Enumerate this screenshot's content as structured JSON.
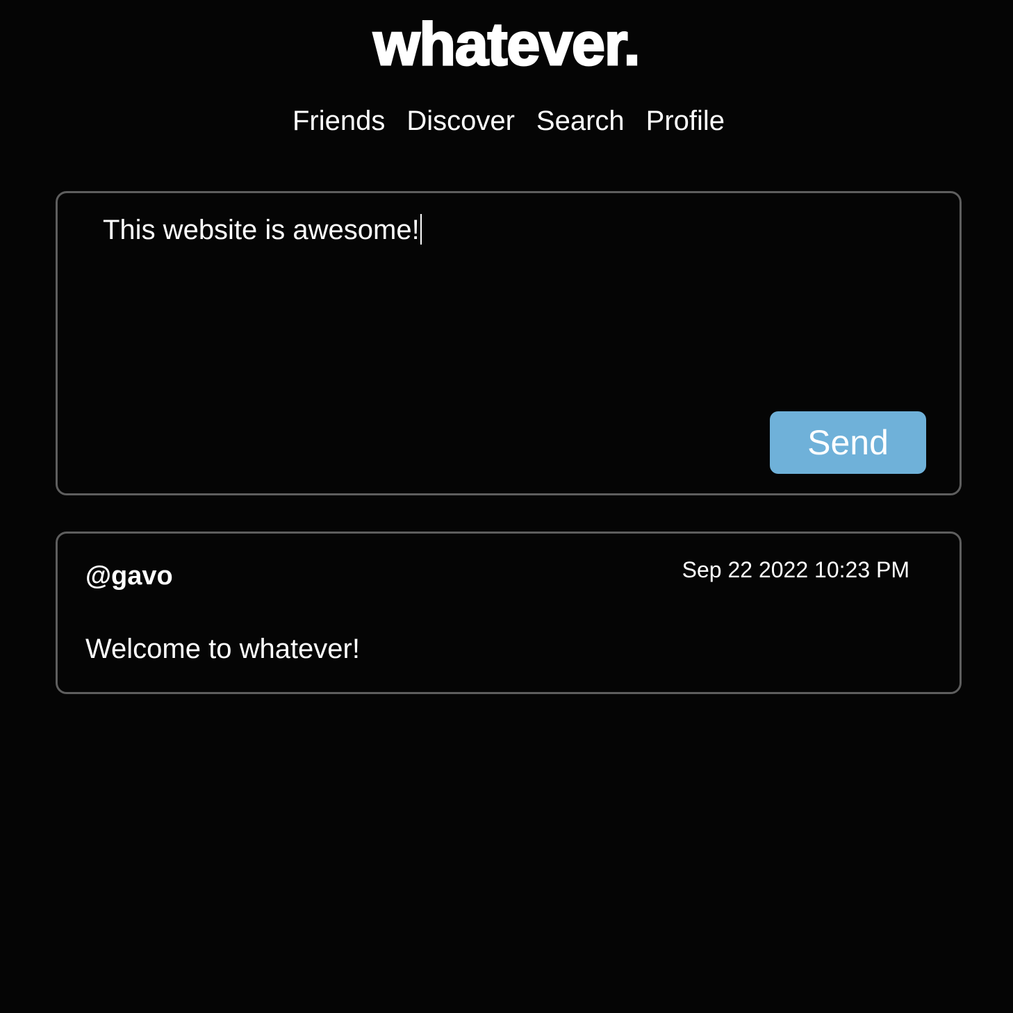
{
  "app": {
    "logo": "whatever."
  },
  "nav": {
    "items": [
      {
        "label": "Friends"
      },
      {
        "label": "Discover"
      },
      {
        "label": "Search"
      },
      {
        "label": "Profile"
      }
    ]
  },
  "composer": {
    "value": "This website is awesome!",
    "send_label": "Send",
    "send_color": "#6fb1d9"
  },
  "feed": {
    "posts": [
      {
        "author": "@gavo",
        "timestamp": "Sep 22 2022 10:23 PM",
        "body": "Welcome to whatever!"
      }
    ]
  },
  "colors": {
    "background": "#050505",
    "border": "#5e5e5e",
    "text": "#ffffff"
  }
}
